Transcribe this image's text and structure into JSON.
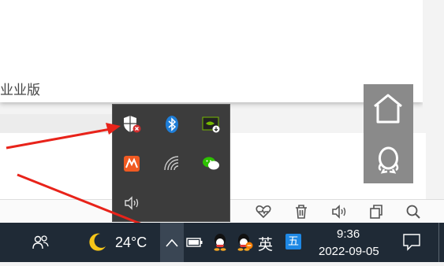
{
  "background_app": {
    "edition_label": "业业版"
  },
  "bottom_toolbar": {
    "icons": [
      "heart-rate-icon",
      "trash-icon",
      "volume-icon",
      "copy-icon",
      "search-icon"
    ]
  },
  "side_tiles": {
    "icons": [
      "home-icon",
      "qq-penguin-icon"
    ]
  },
  "tray_flyout": {
    "icons": [
      "windows-security-warning-icon",
      "bluetooth-icon",
      "nvidia-icon",
      "app-orange-icon",
      "wifi-icon",
      "wechat-icon",
      "speaker-icon"
    ]
  },
  "taskbar": {
    "weather": {
      "icon": "moon-icon",
      "temperature": "24°C"
    },
    "show_hidden_icons": {
      "icon": "chevron-up-icon"
    },
    "tray_icons": [
      "battery-icon",
      "qq-icon",
      "qq-icon-2",
      "ime-mode-icon"
    ],
    "ime_language": "英",
    "ime_wubi": "五",
    "clock": {
      "time": "9:36",
      "date": "2022-09-05"
    }
  },
  "colors": {
    "taskbar_bg": "#1f2a36",
    "flyout_bg": "#3c3c3c",
    "arrow_red": "#e8231a",
    "tile_gray": "#8a8a8a"
  }
}
